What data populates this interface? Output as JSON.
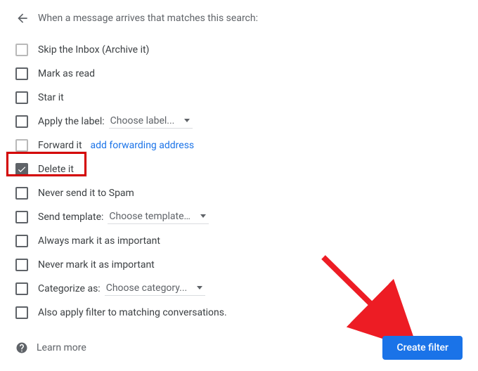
{
  "header": {
    "title": "When a message arrives that matches this search:"
  },
  "options": {
    "archive": {
      "label": "Skip the Inbox (Archive it)",
      "checked": false
    },
    "markRead": {
      "label": "Mark as read",
      "checked": false
    },
    "star": {
      "label": "Star it",
      "checked": false
    },
    "applyLabel": {
      "label": "Apply the label:",
      "select": "Choose label...",
      "checked": false
    },
    "forward": {
      "label": "Forward it",
      "link": "add forwarding address",
      "checked": false
    },
    "delete": {
      "label": "Delete it",
      "checked": true
    },
    "neverSpam": {
      "label": "Never send it to Spam",
      "checked": false
    },
    "sendTemplate": {
      "label": "Send template:",
      "select": "Choose template…",
      "checked": false
    },
    "alwaysImportant": {
      "label": "Always mark it as important",
      "checked": false
    },
    "neverImportant": {
      "label": "Never mark it as important",
      "checked": false
    },
    "categorize": {
      "label": "Categorize as:",
      "select": "Choose category...",
      "checked": false
    },
    "alsoApply": {
      "label": "Also apply filter to matching conversations.",
      "checked": false
    }
  },
  "footer": {
    "learnMore": "Learn more",
    "createButton": "Create filter"
  },
  "annotations": {
    "highlight": "delete-it-row",
    "arrowTarget": "create-filter-button"
  },
  "colors": {
    "primary": "#1a73e8",
    "annotationRed": "#d40000"
  }
}
